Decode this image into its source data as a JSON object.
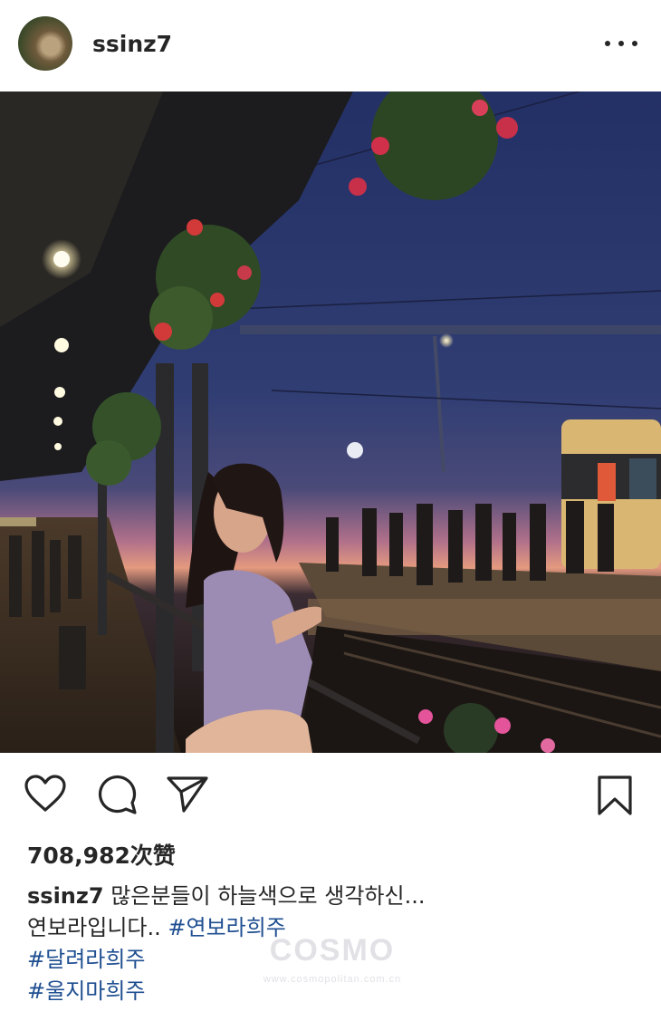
{
  "post": {
    "username": "ssinz7",
    "likes": "708,982次赞",
    "caption": {
      "username": "ssinz7",
      "line1": " 많은분들이 하늘색으로 생각하신...",
      "line2": "연보라입니다.. ",
      "tag1": "#연보라희주",
      "tag2": "#달려라희주",
      "tag3": "#울지마희주"
    }
  },
  "icons": {
    "more": "more-options-icon",
    "like": "heart-icon",
    "comment": "comment-icon",
    "share": "send-icon",
    "save": "bookmark-icon"
  },
  "photo": {
    "description_colors": {
      "sky": "#2a3a6b",
      "dusk": "#e08a7a",
      "platform": "#2b231c"
    }
  },
  "watermark": {
    "logo": "COSMO",
    "url": "www.cosmopolitan.com.cn"
  }
}
